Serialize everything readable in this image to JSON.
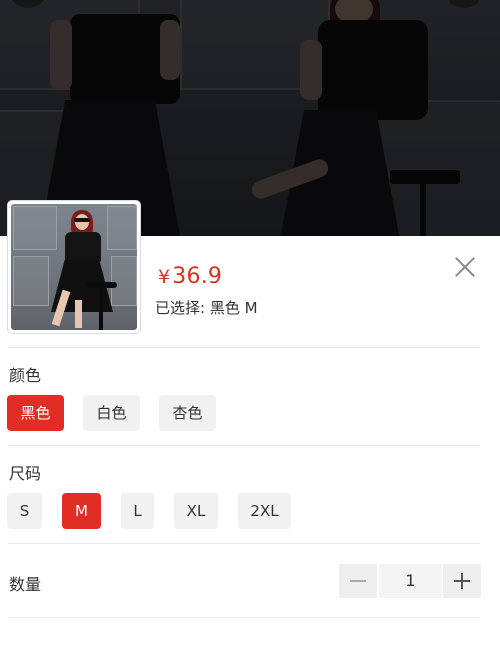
{
  "product": {
    "currency_symbol": "¥",
    "price": "36.9",
    "selected_text": "已选择: 黑色 M"
  },
  "color": {
    "label": "颜色",
    "options": [
      "黑色",
      "白色",
      "杏色"
    ],
    "selected": "黑色"
  },
  "size": {
    "label": "尺码",
    "options": [
      "S",
      "M",
      "L",
      "XL",
      "2XL"
    ],
    "selected": "M"
  },
  "quantity": {
    "label": "数量",
    "value": "1"
  },
  "theme": {
    "accent": "#e02e24",
    "price_color": "#e0301e",
    "option_bg": "#f1f1f1"
  },
  "icons": {
    "close": "close-icon",
    "minus": "minus-icon",
    "plus": "plus-icon"
  }
}
